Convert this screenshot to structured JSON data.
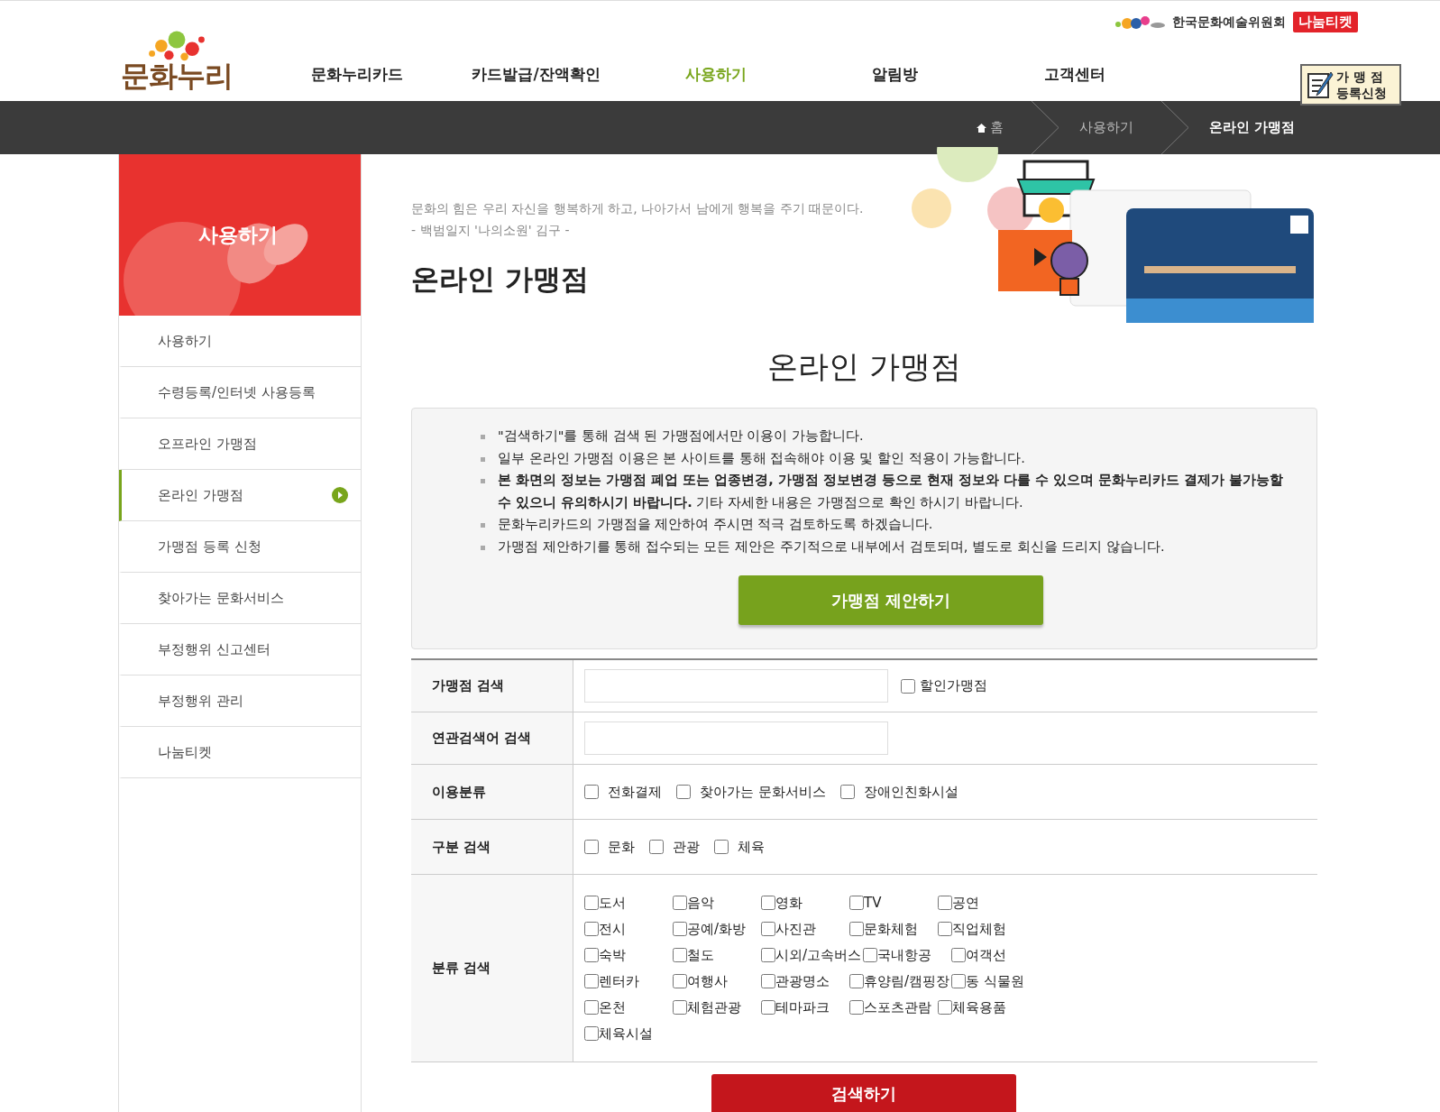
{
  "header": {
    "logo": "문화누리",
    "org": "한국문화예술위원회",
    "ticket_logo": "나눔티켓",
    "register_banner": [
      "가 맹 점",
      "등록신청"
    ]
  },
  "nav": [
    {
      "label": "문화누리카드",
      "selected": false
    },
    {
      "label": "카드발급/잔액확인",
      "selected": false
    },
    {
      "label": "사용하기",
      "selected": true
    },
    {
      "label": "알림방",
      "selected": false
    },
    {
      "label": "고객센터",
      "selected": false
    }
  ],
  "breadcrumb": [
    "홈",
    "사용하기",
    "온라인 가맹점"
  ],
  "sidebar": {
    "title": "사용하기",
    "items": [
      {
        "label": "사용하기",
        "selected": false
      },
      {
        "label": "수령등록/인터넷 사용등록",
        "selected": false
      },
      {
        "label": "오프라인 가맹점",
        "selected": false
      },
      {
        "label": "온라인 가맹점",
        "selected": true
      },
      {
        "label": "가맹점 등록 신청",
        "selected": false
      },
      {
        "label": "찾아가는 문화서비스",
        "selected": false
      },
      {
        "label": "부정행위 신고센터",
        "selected": false
      },
      {
        "label": "부정행위 관리",
        "selected": false
      },
      {
        "label": "나눔티켓",
        "selected": false
      }
    ]
  },
  "quote": [
    "문화의 힘은 우리 자신을 행복하게 하고, 나아가서 남에게 행복을 주기 때문이다.",
    "- 백범일지 '나의소원' 김구 -"
  ],
  "page_title": "온라인 가맹점",
  "section_title": "온라인 가맹점",
  "notices": [
    "\"검색하기\"를 통해 검색 된 가맹점에서만 이용이 가능합니다.",
    "일부 온라인 가맹점 이용은 본 사이트를 통해 접속해야 이용 및 할인 적용이 가능합니다.",
    "**본 화면의 정보는 가맹점 폐업 또는 업종변경, 가맹점 정보변경 등으로 현재 정보와 다를 수 있으며 문화누리카드 결제가 불가능할 수 있으니 유의하시기 바랍니다.** 기타 자세한 내용은 가맹점으로 확인 하시기 바랍니다.",
    "문화누리카드의 가맹점을 제안하여 주시면 적극 검토하도록 하겠습니다.",
    "가맹점 제안하기를 통해 접수되는 모든 제안은 주기적으로 내부에서 검토되며, 별도로 회신을 드리지 않습니다."
  ],
  "propose_button": "가맹점 제안하기",
  "form": {
    "rows": [
      {
        "kind": "text",
        "label": "가맹점 검색",
        "options": [
          {
            "label": "할인가맹점",
            "checked": false
          }
        ]
      },
      {
        "kind": "text",
        "label": "연관검색어 검색"
      },
      {
        "kind": "checks",
        "label": "이용분류",
        "options": [
          {
            "label": "전화결제",
            "checked": false
          },
          {
            "label": "찾아가는 문화서비스",
            "checked": false
          },
          {
            "label": "장애인친화시설",
            "checked": false
          }
        ]
      },
      {
        "kind": "checks",
        "label": "구분 검색",
        "options": [
          {
            "label": "문화",
            "checked": false
          },
          {
            "label": "관광",
            "checked": false
          },
          {
            "label": "체육",
            "checked": false
          }
        ]
      },
      {
        "kind": "grid",
        "label": "분류 검색",
        "options": [
          {
            "label": "도서",
            "checked": false
          },
          {
            "label": "음악",
            "checked": false
          },
          {
            "label": "영화",
            "checked": false
          },
          {
            "label": "TV",
            "checked": false
          },
          {
            "label": "공연",
            "checked": false
          },
          {
            "label": "전시",
            "checked": false
          },
          {
            "label": "공예/화방",
            "checked": false
          },
          {
            "label": "사진관",
            "checked": false
          },
          {
            "label": "문화체험",
            "checked": false
          },
          {
            "label": "직업체험",
            "checked": false
          },
          {
            "label": "숙박",
            "checked": false
          },
          {
            "label": "철도",
            "checked": false
          },
          {
            "label": "시외/고속버스",
            "checked": false
          },
          {
            "label": "국내항공",
            "checked": false
          },
          {
            "label": "여객선",
            "checked": false
          },
          {
            "label": "렌터카",
            "checked": false
          },
          {
            "label": "여행사",
            "checked": false
          },
          {
            "label": "관광명소",
            "checked": false
          },
          {
            "label": "휴양림/캠핑장",
            "checked": false
          },
          {
            "label": "동 식물원",
            "checked": false
          },
          {
            "label": "온천",
            "checked": false
          },
          {
            "label": "체험관광",
            "checked": false
          },
          {
            "label": "테마파크",
            "checked": false
          },
          {
            "label": "스포츠관람",
            "checked": false
          },
          {
            "label": "체육용품",
            "checked": false
          },
          {
            "label": "체육시설",
            "checked": false
          }
        ]
      }
    ]
  },
  "search_button": "검색하기"
}
